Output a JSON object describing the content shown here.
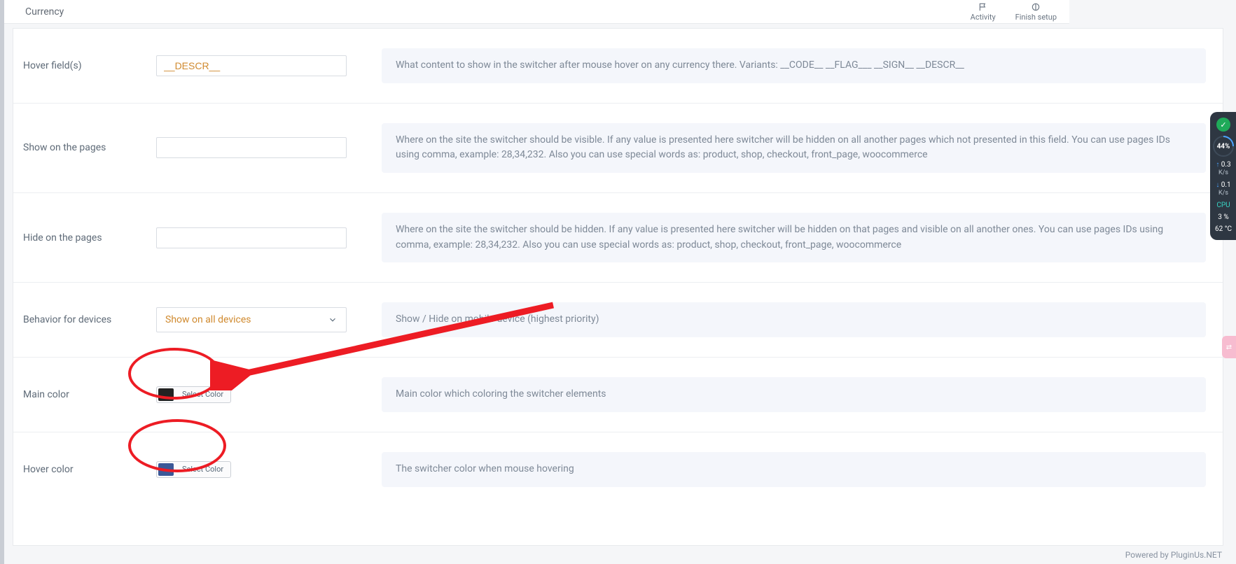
{
  "topbar": {
    "title": "Currency",
    "activity": "Activity",
    "finish_setup": "Finish setup"
  },
  "rows": {
    "hover_fields": {
      "label": "Hover field(s)",
      "value": "__DESCR__",
      "help": "What content to show in the switcher after mouse hover on any currency there. Variants: __CODE__ __FLAG___ __SIGN__ __DESCR__"
    },
    "show_on_pages": {
      "label": "Show on the pages",
      "value": "",
      "help": "Where on the site the switcher should be visible. If any value is presented here switcher will be hidden on all another pages which not presented in this field. You can use pages IDs using comma, example: 28,34,232. Also you can use special words as: product, shop, checkout, front_page, woocommerce"
    },
    "hide_on_pages": {
      "label": "Hide on the pages",
      "value": "",
      "help": "Where on the site the switcher should be hidden. If any value is presented here switcher will be hidden on that pages and visible on all another ones. You can use pages IDs using comma, example: 28,34,232. Also you can use special words as: product, shop, checkout, front_page, woocommerce"
    },
    "behavior": {
      "label": "Behavior for devices",
      "selected": "Show on all devices",
      "help": "Show / Hide on mobile device (highest priority)"
    },
    "main_color": {
      "label": "Main color",
      "swatch": "#222222",
      "button_label": "Select Color",
      "help": "Main color which coloring the switcher elements"
    },
    "hover_color": {
      "label": "Hover color",
      "swatch": "#3b5998",
      "button_label": "Select Color",
      "help": "The switcher color when mouse hovering"
    }
  },
  "footer": "Powered by PluginUs.NET",
  "sys_widget": {
    "gauge": "44%",
    "up": "0.3",
    "up_unit": "K/s",
    "down": "0.1",
    "down_unit": "K/s",
    "cpu_label": "CPU",
    "cpu_pct": "3 %",
    "temp": "62 °C"
  }
}
